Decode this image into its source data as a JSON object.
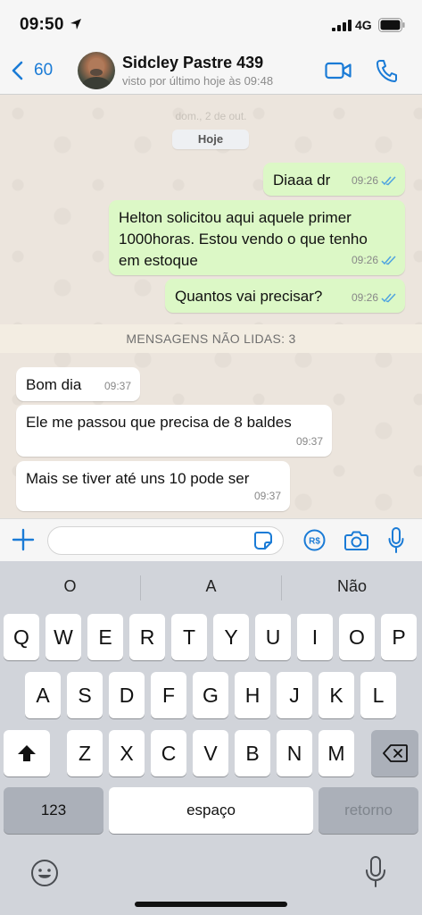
{
  "status_bar": {
    "time": "09:50",
    "network": "4G",
    "icons": [
      "location-arrow-icon",
      "signal-bars-icon",
      "battery-icon"
    ]
  },
  "header": {
    "back_count": "60",
    "contact_name": "Sidcley Pastre 439",
    "last_seen": "visto por último hoje às 09:48",
    "accent_color": "#1a7bd6",
    "icons": [
      "chevron-left-icon",
      "video-call-icon",
      "phone-icon"
    ]
  },
  "chat": {
    "faded_date": "dom., 2 de out.",
    "date_pill": "Hoje",
    "outgoing": [
      {
        "text": "Diaaa dr",
        "time": "09:26"
      },
      {
        "text": "Helton solicitou aqui aquele primer\n1000horas. Estou vendo o que tenho\nem estoque",
        "time": "09:26"
      },
      {
        "text": "Quantos vai precisar?",
        "time": "09:26"
      }
    ],
    "unread_banner": "MENSAGENS NÃO LIDAS: 3",
    "incoming": [
      {
        "text": "Bom dia",
        "time": "09:37"
      },
      {
        "text": "Ele me passou que precisa de 8 baldes",
        "time": "09:37"
      },
      {
        "text": "Mais se tiver até uns 10 pode ser",
        "time": "09:37"
      }
    ],
    "colors": {
      "outgoing_bubble": "#dcf8c6",
      "incoming_bubble": "#ffffff",
      "read_ticks": "#4fa3e0"
    }
  },
  "input_bar": {
    "placeholder": "",
    "icons": [
      "plus-icon",
      "sticker-icon",
      "payment-icon",
      "camera-icon",
      "microphone-icon"
    ]
  },
  "keyboard": {
    "suggestions": [
      "O",
      "A",
      "Não"
    ],
    "row1": [
      "Q",
      "W",
      "E",
      "R",
      "T",
      "Y",
      "U",
      "I",
      "O",
      "P"
    ],
    "row2": [
      "A",
      "S",
      "D",
      "F",
      "G",
      "H",
      "J",
      "K",
      "L"
    ],
    "row3": [
      "Z",
      "X",
      "C",
      "V",
      "B",
      "N",
      "M"
    ],
    "numbers_key": "123",
    "space_key": "espaço",
    "return_key": "retorno",
    "icons": [
      "shift-icon",
      "backspace-icon",
      "emoji-icon",
      "dictation-mic-icon"
    ]
  }
}
